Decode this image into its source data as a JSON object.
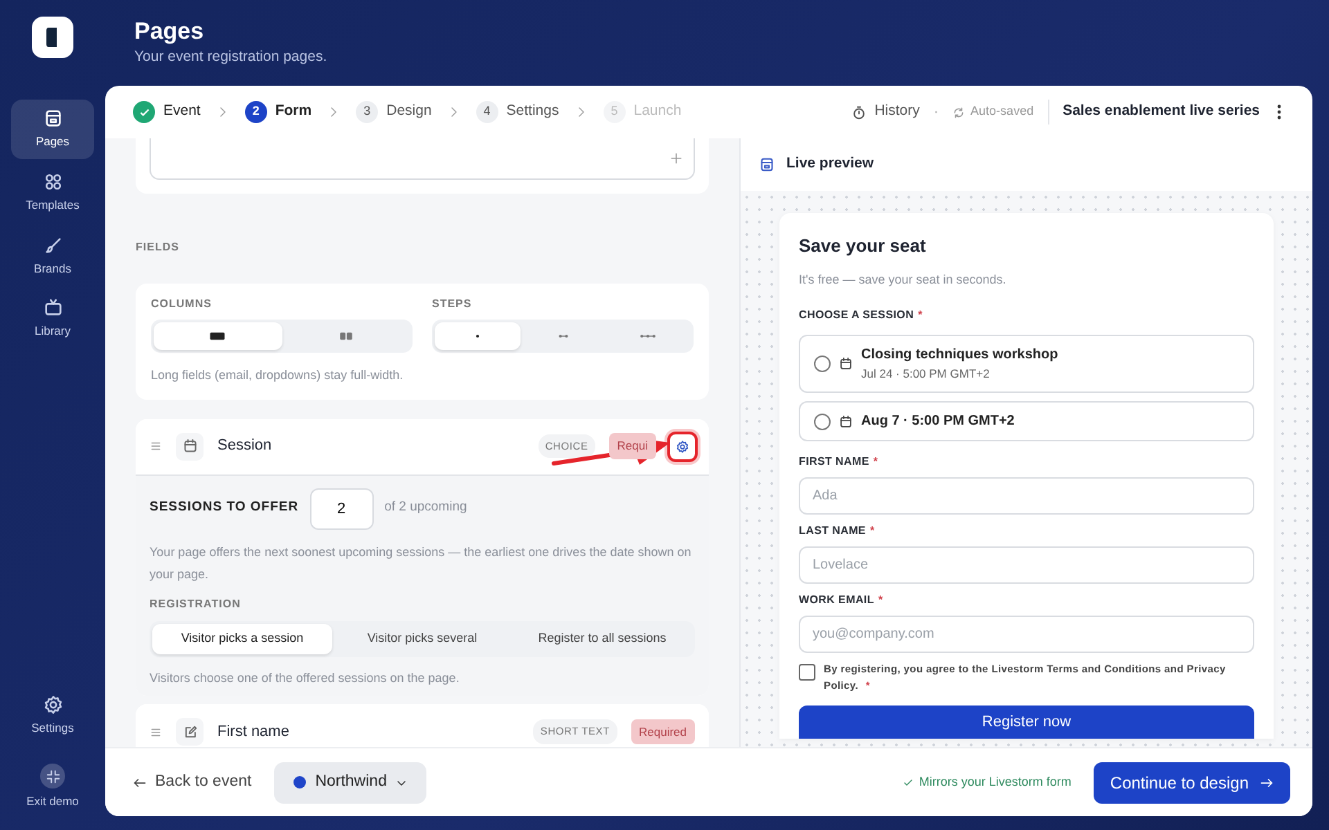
{
  "sidebar": {
    "items": [
      {
        "label": "Pages",
        "selected": true
      },
      {
        "label": "Templates",
        "selected": false
      },
      {
        "label": "Brands",
        "selected": false
      },
      {
        "label": "Library",
        "selected": false
      }
    ],
    "bottom_items": [
      {
        "label": "Settings"
      },
      {
        "label": "Exit demo"
      }
    ]
  },
  "header": {
    "title": "Pages",
    "subtitle": "Your event registration pages."
  },
  "stepper": [
    {
      "label": "Event",
      "completed": true,
      "selected": false,
      "disabled": false
    },
    {
      "number": "2",
      "label": "Form",
      "completed": false,
      "selected": true,
      "disabled": false
    },
    {
      "number": "3",
      "label": "Design",
      "completed": false,
      "selected": false,
      "disabled": false
    },
    {
      "number": "4",
      "label": "Settings",
      "completed": false,
      "selected": false,
      "disabled": false
    },
    {
      "number": "5",
      "label": "Launch",
      "completed": false,
      "selected": false,
      "disabled": true
    }
  ],
  "toolbar": {
    "history": "History",
    "separator": "·",
    "autosave": "Auto-saved",
    "event_name": "Sales enablement live series"
  },
  "fields_heading": "FIELDS",
  "layout_card": {
    "columns_label": "COLUMNS",
    "columns_options": [
      {
        "kind": "one",
        "selected": true
      },
      {
        "kind": "two",
        "selected": false
      }
    ],
    "steps_label": "STEPS",
    "steps_options": [
      {
        "kind": "one",
        "selected": true
      },
      {
        "kind": "two",
        "selected": false
      },
      {
        "kind": "three",
        "selected": false
      }
    ],
    "note": "Long fields (email, dropdowns) stay full-width."
  },
  "fields": [
    {
      "label": "Session",
      "kind": "choice",
      "type": "CHOICE",
      "badge": "Requi",
      "expanded": true,
      "settings_highlighted": true
    },
    {
      "label": "First name",
      "kind": "text",
      "type": "SHORT TEXT",
      "badge": "Required",
      "expanded": false,
      "settings_highlighted": false
    }
  ],
  "session_settings": {
    "offer_label": "SESSIONS TO OFFER",
    "offer_value": "2",
    "offer_suffix": "of 2 upcoming",
    "description": "Your page offers the next soonest upcoming sessions — the earliest one drives the date shown on your page.",
    "registration_label": "REGISTRATION",
    "registration_options": [
      {
        "label": "Visitor picks a session",
        "selected": true
      },
      {
        "label": "Visitor picks several",
        "selected": false
      },
      {
        "label": "Register to all sessions",
        "selected": false
      }
    ],
    "note": "Visitors choose one of the offered sessions on the page."
  },
  "preview": {
    "title": "Live preview",
    "form_title": "Save your seat",
    "subtitle": "It's free — save your seat in seconds.",
    "session_label": "CHOOSE A SESSION",
    "session_required_mark": "*",
    "sessions": [
      {
        "title": "Closing techniques workshop",
        "subtitle": "Jul 24 · 5:00 PM GMT+2",
        "selected": false
      },
      {
        "title": "Aug 7 · 5:00 PM GMT+2",
        "selected": false
      }
    ],
    "fields": [
      {
        "label": "FIRST NAME",
        "required_mark": "*",
        "placeholder": "Ada"
      },
      {
        "label": "LAST NAME",
        "required_mark": "*",
        "placeholder": "Lovelace"
      },
      {
        "label": "WORK EMAIL",
        "required_mark": "*",
        "placeholder": "you@company.com"
      }
    ],
    "consent": {
      "text": "By registering, you agree to the Livestorm Terms and Conditions and Privacy Policy.",
      "required_mark": "*",
      "checked": false
    },
    "submit": "Register now"
  },
  "footer": {
    "back": "Back to event",
    "brand": {
      "name": "Northwind",
      "color": "#1f45c9"
    },
    "status": "Mirrors your Livestorm form",
    "continue": "Continue to design"
  }
}
